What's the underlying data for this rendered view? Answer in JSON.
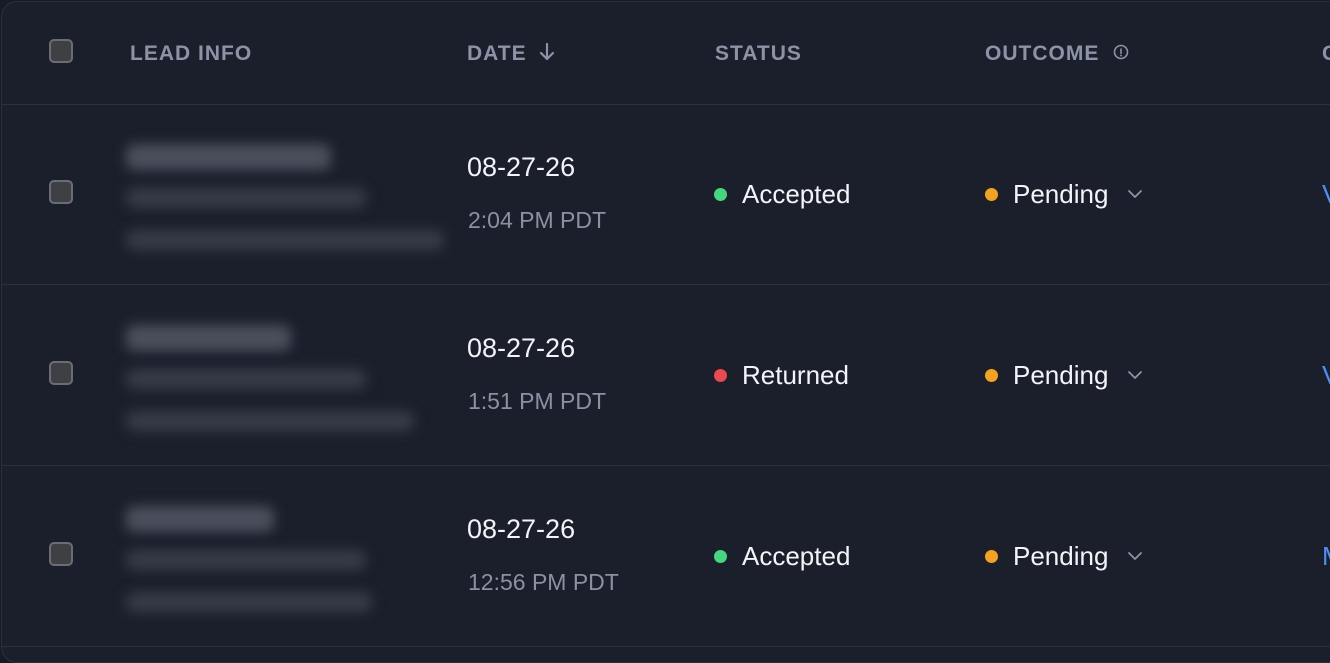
{
  "colors": {
    "accepted": "#45d77d",
    "returned": "#ea4a4f",
    "pending": "#f3a320",
    "link": "#4d8ef7"
  },
  "header": {
    "lead_info": "LEAD INFO",
    "date": "DATE",
    "status": "STATUS",
    "outcome": "OUTCOME",
    "next_partial": "C"
  },
  "rows": [
    {
      "date": "08-27-26",
      "time": "2:04 PM PDT",
      "status": "Accepted",
      "status_color": "#45d77d",
      "outcome": "Pending",
      "action_partial": "V"
    },
    {
      "date": "08-27-26",
      "time": "1:51 PM PDT",
      "status": "Returned",
      "status_color": "#ea4a4f",
      "outcome": "Pending",
      "action_partial": "V"
    },
    {
      "date": "08-27-26",
      "time": "12:56 PM PDT",
      "status": "Accepted",
      "status_color": "#45d77d",
      "outcome": "Pending",
      "action_partial": "M"
    }
  ]
}
